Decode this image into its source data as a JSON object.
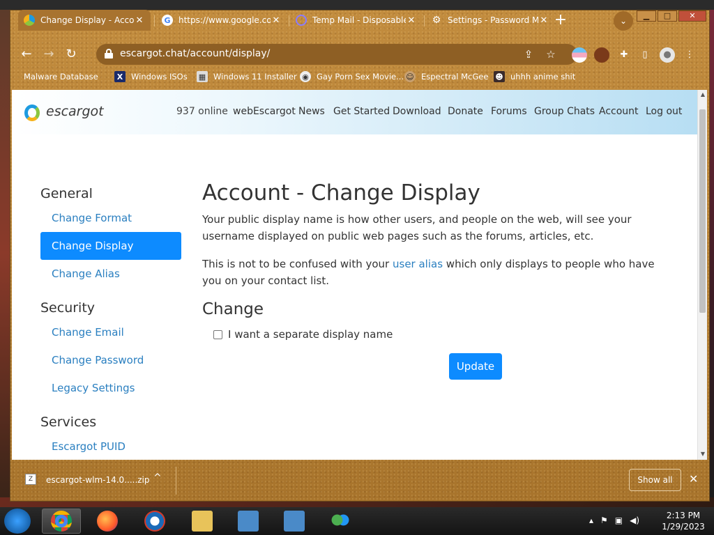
{
  "window_controls": {
    "minimize": "▁",
    "maximize": "□",
    "close": "✕"
  },
  "tabs": [
    {
      "title": "Change Display - Account",
      "icon": "escargot-icon",
      "active": true
    },
    {
      "title": "https://www.google.com/",
      "icon": "google-icon",
      "active": false
    },
    {
      "title": "Temp Mail - Disposable",
      "icon": "tempmail-icon",
      "active": false
    },
    {
      "title": "Settings - Password Manager",
      "icon": "gear-icon",
      "active": false
    }
  ],
  "toolbar": {
    "url": "escargot.chat/account/display/"
  },
  "bookmarks": [
    {
      "label": "Malware Database",
      "icon": "folder-icon"
    },
    {
      "label": "Windows ISOs",
      "icon": "x-icon"
    },
    {
      "label": "Windows 11 Installer",
      "icon": "installer-icon"
    },
    {
      "label": "Gay Porn Sex Movie...",
      "icon": "bookmark-icon"
    },
    {
      "label": "Espectral McGee",
      "icon": "avatar-icon"
    },
    {
      "label": "uhhh anime shit",
      "icon": "anime-icon"
    }
  ],
  "site": {
    "brand": "escargot",
    "nav": [
      "937 online",
      "webEscargot",
      "News",
      "Get Started",
      "Download",
      "Donate",
      "Forums",
      "Group Chats",
      "Account",
      "Log out"
    ],
    "accent": "#0d8bff",
    "link_color": "#2a7fc0"
  },
  "sidebar": {
    "general_heading": "General",
    "general_items": [
      "Change Format",
      "Change Display",
      "Change Alias"
    ],
    "security_heading": "Security",
    "security_items": [
      "Change Email",
      "Change Password",
      "Legacy Settings"
    ],
    "services_heading": "Services",
    "services_items": [
      "Escargot PUID"
    ],
    "active_item": "Change Display"
  },
  "main": {
    "title": "Account - Change Display",
    "para1": "Your public display name is how other users, and people on the web, will see your username displayed on public web pages such as the forums, articles, etc.",
    "para2_before": "This is not to be confused with your ",
    "para2_link": "user alias",
    "para2_after": " which only displays to people who have you on your contact list.",
    "change_heading": "Change",
    "checkbox_label": "I want a separate display name",
    "checkbox_checked": false,
    "update_button": "Update"
  },
  "download_bar": {
    "filename": "escargot-wlm-14.0.....zip",
    "show_all": "Show all",
    "close": "✕"
  },
  "taskbar": {
    "clock_time": "2:13 PM",
    "clock_date": "1/29/2023"
  }
}
